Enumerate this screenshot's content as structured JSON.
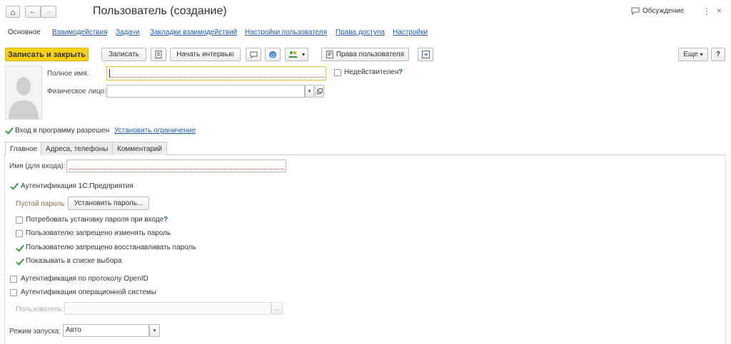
{
  "header": {
    "home_label": "⌂",
    "back_label": "←",
    "forward_label": "→",
    "title": "Пользователь (создание)",
    "discussion_label": "Обсуждение",
    "more_label": "⋮",
    "close_label": "×"
  },
  "nav": {
    "main": "Основное",
    "links": [
      "Взаимодействия",
      "Задачи",
      "Закладки взаимодействий",
      "Настройки пользователя",
      "Права доступа",
      "Настройки"
    ]
  },
  "toolbar": {
    "save_close": "Записать и закрыть",
    "save": "Записать",
    "start_interview": "Начать интервью",
    "user_rights": "Права пользователя",
    "more": "Еще",
    "help": "?",
    "chevron": "▾"
  },
  "form": {
    "full_name_label": "Полное имя:",
    "full_name_value": "",
    "inactive_label": "Недействителен",
    "help": "?",
    "person_label": "Физическое лицо:",
    "person_value": "",
    "login_allowed": "Вход в программу разрешен",
    "set_restriction": "Установить ограничение"
  },
  "tabs": [
    "Главное",
    "Адреса, телефоны",
    "Комментарий"
  ],
  "main": {
    "login_name_label": "Имя (для входа):",
    "login_name_value": "",
    "auth_1c": "Аутентификация 1С:Предприятия",
    "empty_password": "Пустой пароль",
    "set_password": "Установить пароль...",
    "opt_require_password": "Потребовать установку пароля при входе",
    "opt_no_change": "Пользователю запрещено изменять пароль",
    "opt_no_restore": "Пользователю запрещено восстанавливать пароль",
    "opt_show_in_list": "Показывать в списке выбора",
    "auth_openid": "Аутентификация по протоколу OpenID",
    "auth_os": "Аутентификация операционной системы",
    "os_user_label": "Пользователь:",
    "os_user_value": "",
    "ellipsis": "...",
    "launch_mode_label": "Режим запуска:",
    "launch_mode_value": "Авто",
    "dropdown": "▾"
  },
  "colors": {
    "accent_yellow": "#f7d117",
    "link": "#1f5aa8",
    "check": "#3a9a3a",
    "error_underline": "#d04a4a"
  }
}
